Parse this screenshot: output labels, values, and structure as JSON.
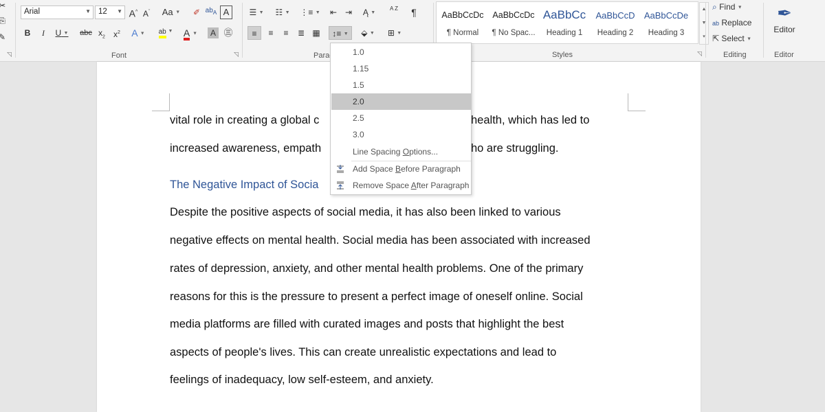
{
  "font": {
    "name": "Arial",
    "size": "12",
    "grow_glyph": "A",
    "shrink_glyph": "A",
    "case_label": "Aa",
    "bold": "B",
    "italic": "I",
    "underline": "U",
    "strike": "abc",
    "subscript": "x",
    "superscript": "x",
    "text_effects_glyph": "A",
    "highlight_glyph": "ab",
    "font_color_glyph": "A",
    "char_shading_glyph": "A",
    "enclose_glyph": "A",
    "group_label": "Font"
  },
  "paragraph": {
    "group_label": "Parag",
    "sort_glyph": "A Z",
    "pilcrow": "¶"
  },
  "styles": {
    "group_label": "Styles",
    "items": [
      {
        "preview": "AaBbCcDc",
        "name": "¶ Normal"
      },
      {
        "preview": "AaBbCcDc",
        "name": "¶ No Spac..."
      },
      {
        "preview": "AaBbCc",
        "name": "Heading 1"
      },
      {
        "preview": "AaBbCcD",
        "name": "Heading 2"
      },
      {
        "preview": "AaBbCcDe",
        "name": "Heading 3"
      }
    ]
  },
  "editing": {
    "group_label": "Editing",
    "find": "Find",
    "replace": "Replace",
    "select": "Select"
  },
  "editor": {
    "label": "Editor",
    "group_label": "Editor"
  },
  "line_spacing_menu": {
    "items": [
      "1.0",
      "1.15",
      "1.5",
      "2.0",
      "2.5",
      "3.0"
    ],
    "selected": "2.0",
    "options_label_pre": "Line Spacing ",
    "options_label_key": "O",
    "options_label_post": "ptions...",
    "add_before_pre": "Add Space ",
    "add_before_key": "B",
    "add_before_post": "efore Paragraph",
    "remove_after_pre": "Remove Space ",
    "remove_after_key": "A",
    "remove_after_post": "fter Paragraph"
  },
  "document": {
    "line1_left": "vital role in creating a global c",
    "line1_right": "health, which has led to",
    "line2_left": "increased awareness, empath",
    "line2_right": "ho are struggling.",
    "heading": "The Negative Impact of Socia",
    "paragraph": [
      "Despite the positive aspects of social media, it has also been linked to various",
      "negative effects on mental health. Social media has been associated with increased",
      "rates of depression, anxiety, and other mental health problems. One of the primary",
      "reasons for this is the pressure to present a perfect image of oneself online. Social",
      "media platforms are filled with curated images and posts that highlight the best",
      "aspects of people's lives. This can create unrealistic expectations and lead to",
      "feelings of inadequacy, low self-esteem, and anxiety."
    ]
  },
  "colors": {
    "heading_blue": "#2f5597",
    "highlight_yellow": "#ffff00",
    "font_red": "#e02020",
    "menu_selected": "#c8c8c8"
  }
}
